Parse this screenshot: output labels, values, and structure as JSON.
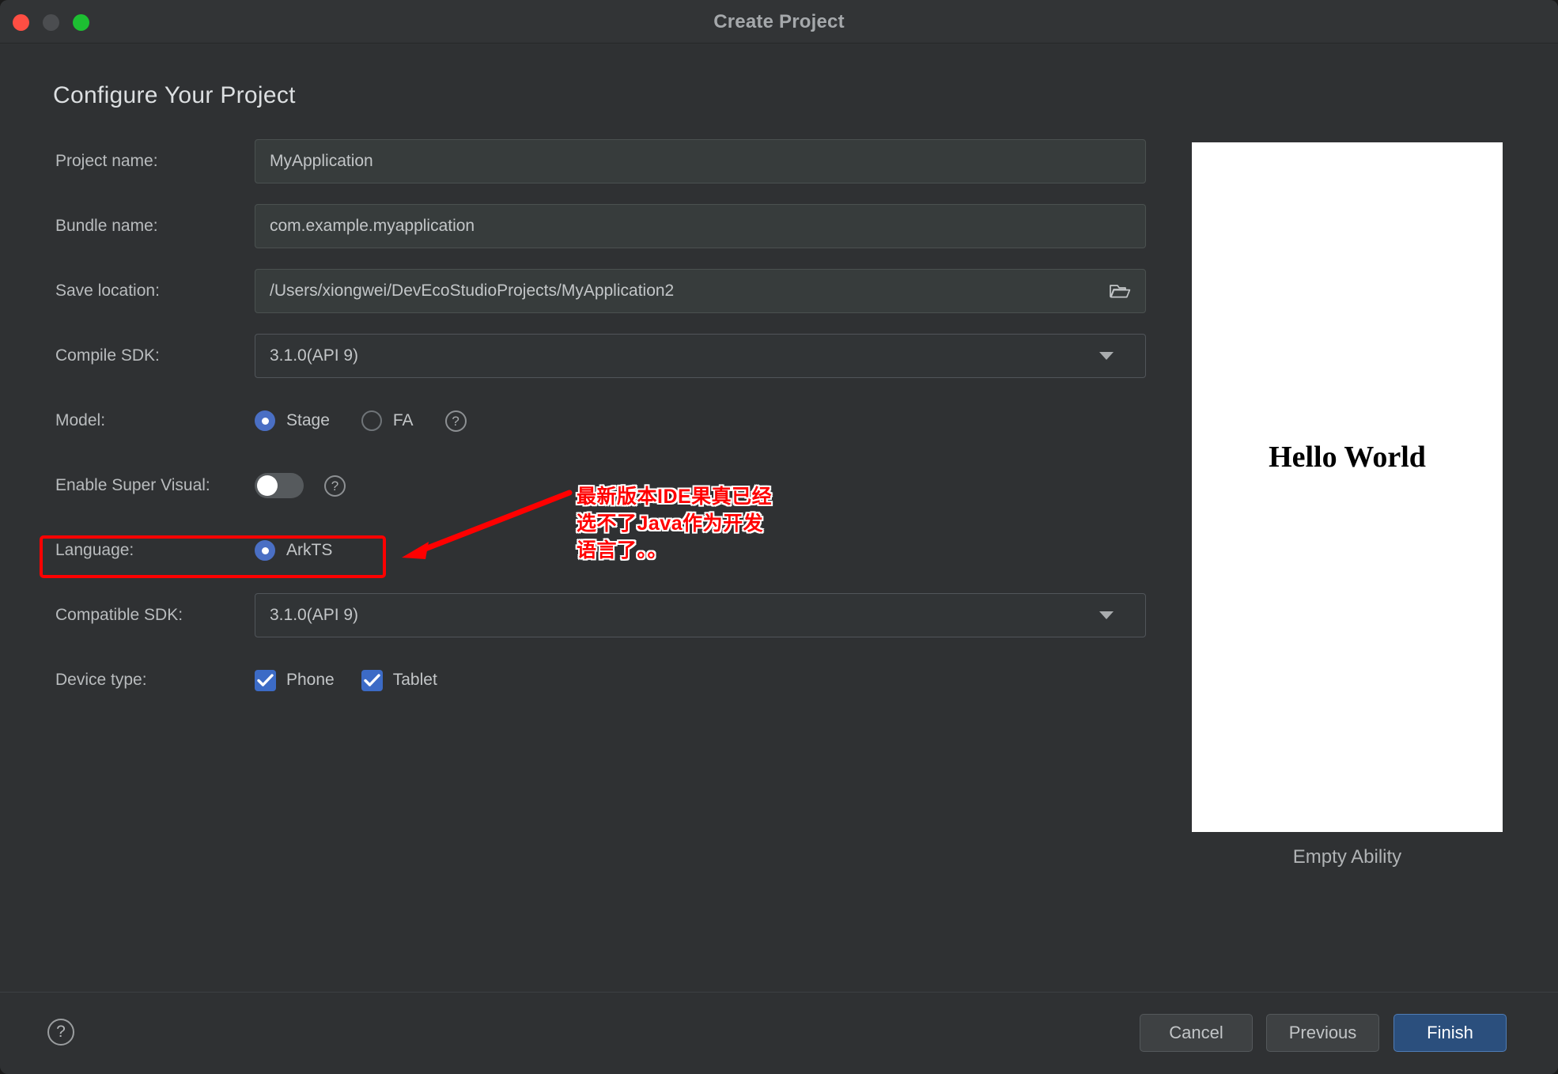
{
  "window": {
    "title": "Create Project",
    "traffic_lights": [
      "close",
      "minimize",
      "maximize"
    ]
  },
  "page": {
    "heading": "Configure Your Project"
  },
  "form": {
    "project_name": {
      "label": "Project name:",
      "value": "MyApplication"
    },
    "bundle_name": {
      "label": "Bundle name:",
      "value": "com.example.myapplication"
    },
    "save_location": {
      "label": "Save location:",
      "value": "/Users/xiongwei/DevEcoStudioProjects/MyApplication2",
      "browse_icon": "folder-icon"
    },
    "compile_sdk": {
      "label": "Compile SDK:",
      "value": "3.1.0(API 9)",
      "caret_icon": "chevron-down-icon"
    },
    "model": {
      "label": "Model:",
      "options": [
        {
          "label": "Stage",
          "selected": true
        },
        {
          "label": "FA",
          "selected": false
        }
      ],
      "help_icon": "question-mark-icon"
    },
    "enable_super_visual": {
      "label": "Enable Super Visual:",
      "state": "off",
      "help_icon": "question-mark-icon"
    },
    "language": {
      "label": "Language:",
      "options": [
        {
          "label": "ArkTS",
          "selected": true
        }
      ],
      "highlight_color": "#ff0000"
    },
    "compatible_sdk": {
      "label": "Compatible SDK:",
      "value": "3.1.0(API 9)",
      "caret_icon": "chevron-down-icon"
    },
    "device_type": {
      "label": "Device type:",
      "options": [
        {
          "label": "Phone",
          "checked": true
        },
        {
          "label": "Tablet",
          "checked": true
        }
      ]
    }
  },
  "annotation": {
    "text": "最新版本IDE果真已经\n选不了Java作为开发\n语言了。。",
    "color": "#ff0000"
  },
  "preview": {
    "screen_text": "Hello World",
    "caption": "Empty Ability"
  },
  "footer": {
    "help_icon": "question-mark-icon",
    "cancel_label": "Cancel",
    "previous_label": "Previous",
    "finish_label": "Finish",
    "finish_color": "#2b4f7d"
  }
}
